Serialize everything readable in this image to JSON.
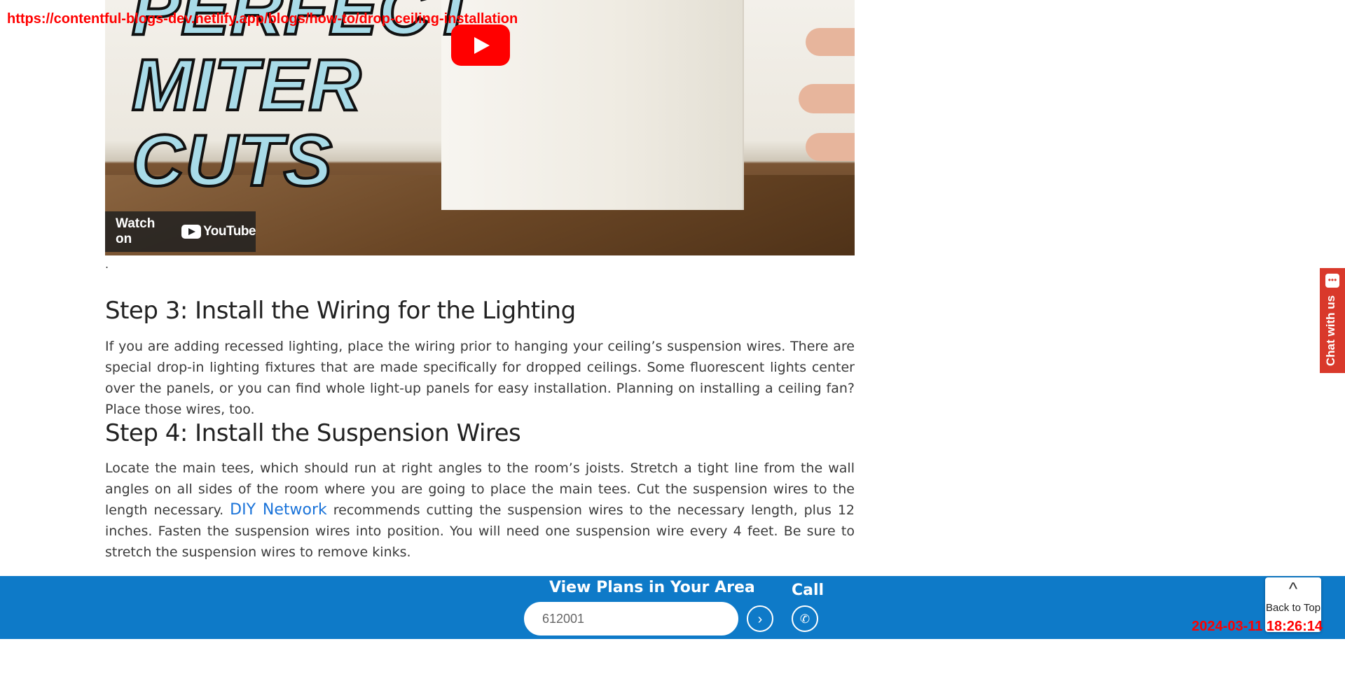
{
  "overlay": {
    "url": "https://contentful-blogs-dev.netlify.app/blogs/how-to/drop-ceiling-installation",
    "timestamp": "2024-03-11 18:26:14"
  },
  "video": {
    "thumbnail_text": [
      "PERFECT",
      "MITER",
      "CUTS"
    ],
    "watch_on_label": "Watch on",
    "youtube_label": "YouTube",
    "play_icon": "play-icon"
  },
  "article": {
    "trailing_dot": ".",
    "step3": {
      "heading": "Step 3: Install the Wiring for the Lighting",
      "body": "If you are adding recessed lighting, place the wiring prior to hanging your ceiling’s suspension wires. There are special drop-in lighting fixtures that are made specifically for dropped ceilings. Some fluorescent lights center over the panels, or you can find whole light-up panels for easy installation. Planning on installing a ceiling fan? Place those wires, too."
    },
    "step4": {
      "heading": "Step 4: Install the Suspension Wires",
      "body_before_link": "Locate the main tees, which should run at right angles to the room’s joists. Stretch a tight line from the wall angles on all sides of the room where you are going to place the main tees. Cut the suspension wires to the length necessary. ",
      "link_text": "DIY Network",
      "body_after_link": " recommends cutting the suspension wires to the necessary length, plus 12 inches. Fasten the suspension wires into position. You will need one suspension wire every 4 feet. Be sure to stretch the suspension wires to remove kinks."
    }
  },
  "chat": {
    "label": "Chat with us",
    "icon": "chat-bubble-icon"
  },
  "bottom_bar": {
    "plans_title": "View Plans in Your Area",
    "zip_value": "612001",
    "submit_icon": "chevron-right-icon",
    "call_label": "Call",
    "call_icon": "phone-icon",
    "back_to_top_label": "Back to Top",
    "back_to_top_icon": "chevron-up-icon"
  },
  "colors": {
    "bar_blue": "#0e7ac8",
    "link_blue": "#1a73d9",
    "chat_red": "#d9392b",
    "overlay_red": "#ff0000",
    "youtube_red": "#ff0000"
  }
}
